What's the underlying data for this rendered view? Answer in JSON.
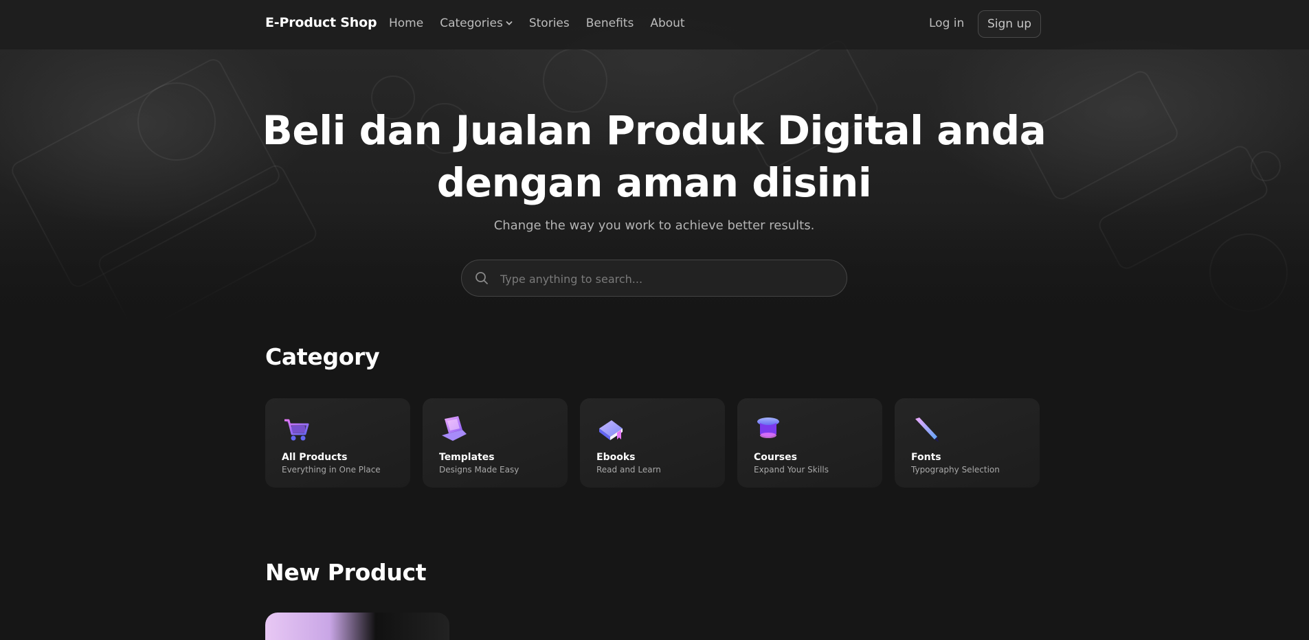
{
  "brand": "E-Product Shop",
  "nav": {
    "items": [
      {
        "label": "Home",
        "dropdown": false
      },
      {
        "label": "Categories",
        "dropdown": true
      },
      {
        "label": "Stories",
        "dropdown": false
      },
      {
        "label": "Benefits",
        "dropdown": false
      },
      {
        "label": "About",
        "dropdown": false
      }
    ],
    "login": "Log in",
    "signup": "Sign up"
  },
  "hero": {
    "title_line1": "Beli dan Jualan Produk Digital anda",
    "title_line2": "dengan aman disini",
    "subtitle": "Change the way you work to achieve better results.",
    "search_placeholder": "Type anything to search..."
  },
  "category": {
    "heading": "Category",
    "items": [
      {
        "title": "All Products",
        "subtitle": "Everything in One Place",
        "icon": "shopping-cart-icon"
      },
      {
        "title": "Templates",
        "subtitle": "Designs Made Easy",
        "icon": "laptop-icon"
      },
      {
        "title": "Ebooks",
        "subtitle": "Read and Learn",
        "icon": "book-icon"
      },
      {
        "title": "Courses",
        "subtitle": "Expand Your Skills",
        "icon": "graduation-cap-icon"
      },
      {
        "title": "Fonts",
        "subtitle": "Typography Selection",
        "icon": "pen-icon"
      }
    ]
  },
  "new_product": {
    "heading": "New Product"
  },
  "colors": {
    "background": "#161616",
    "card": "#222222",
    "icon_purple": "#8b5cf6",
    "icon_pink": "#e879f9",
    "icon_blue": "#6366f1"
  }
}
